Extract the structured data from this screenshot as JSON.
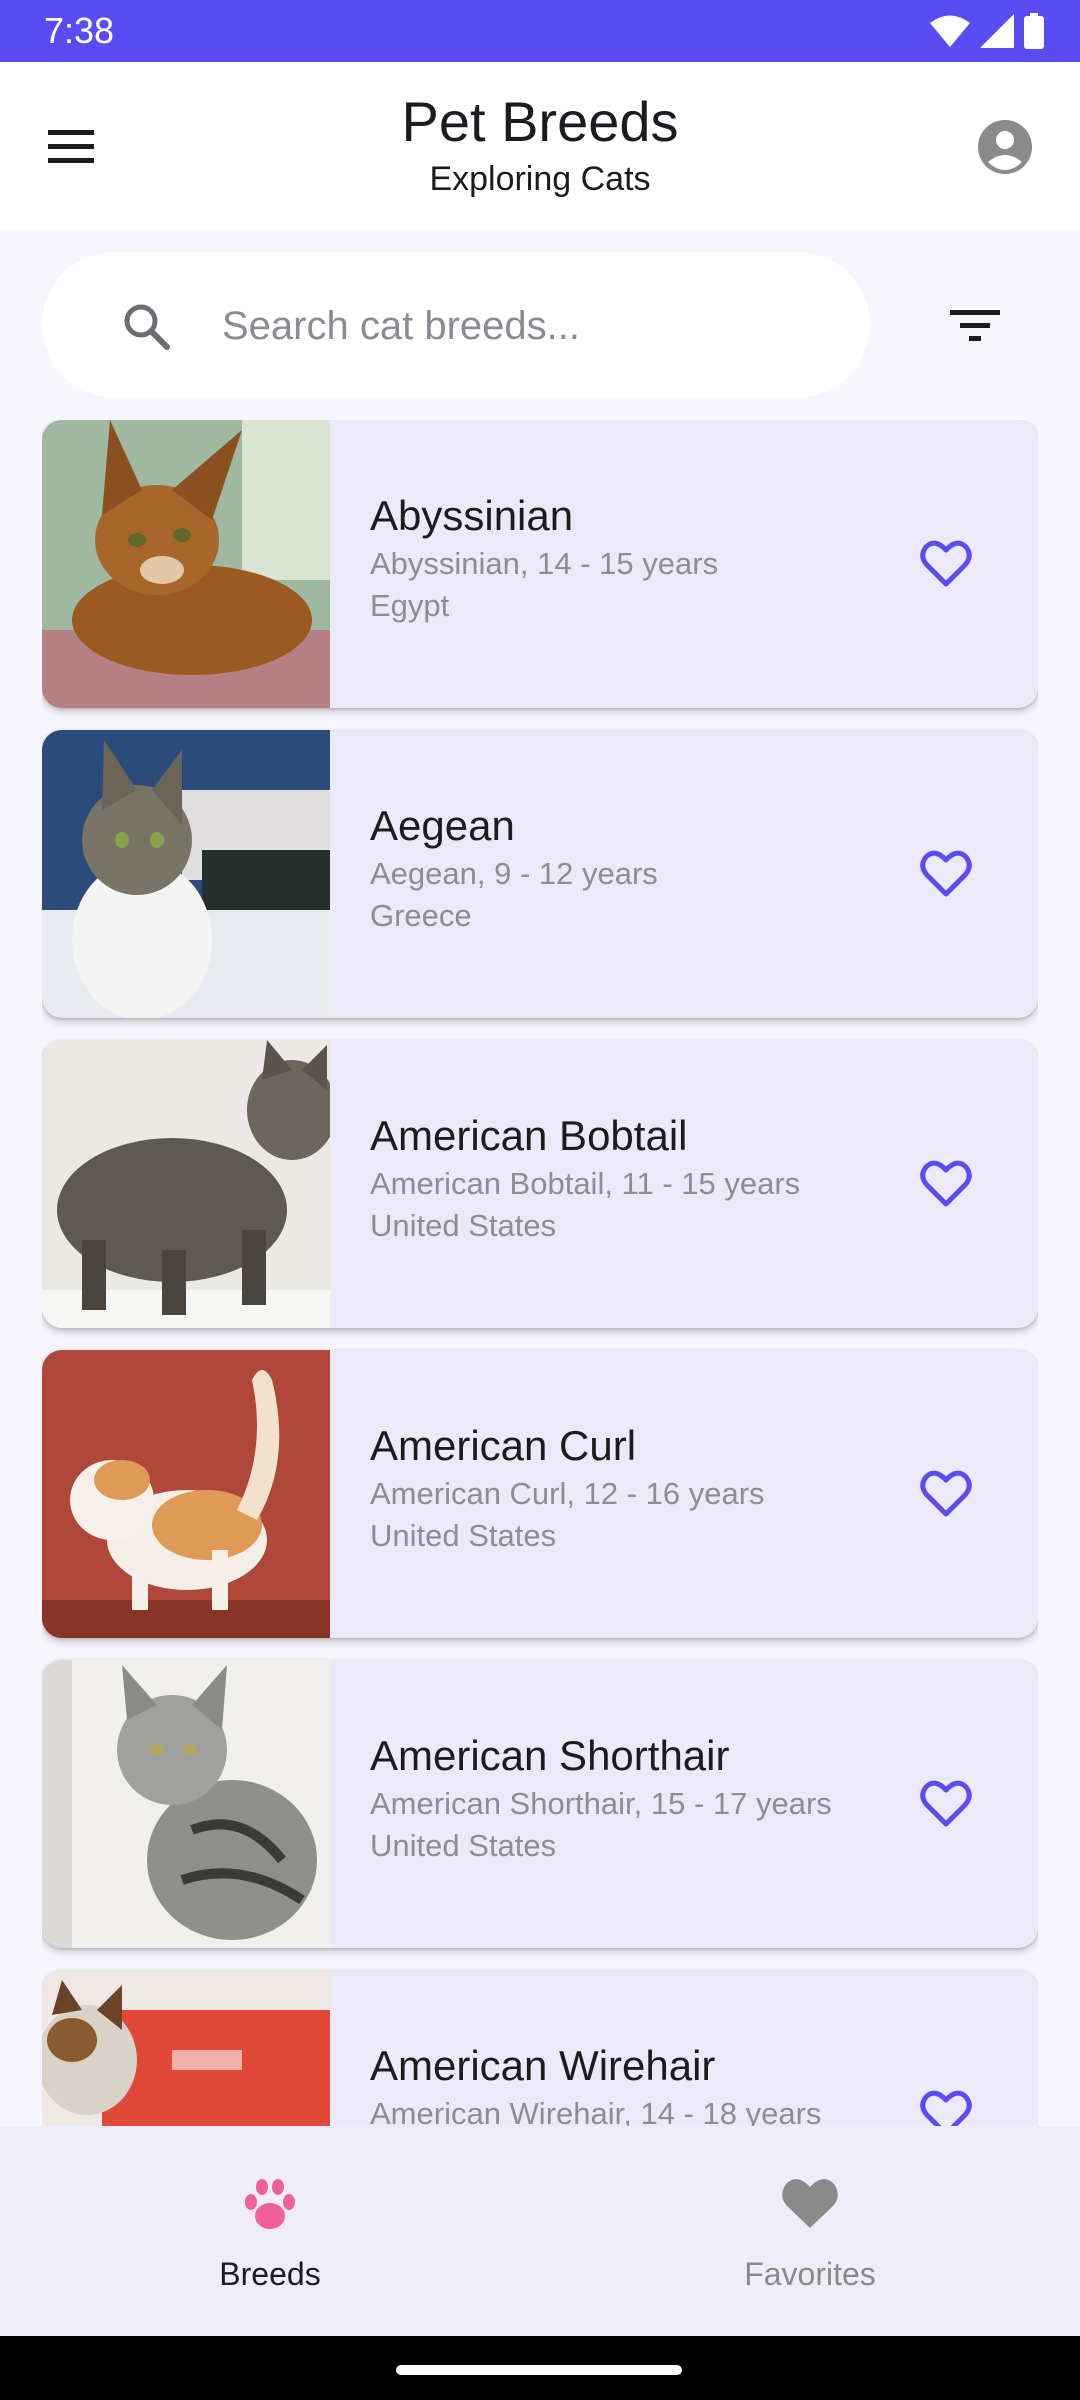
{
  "status_bar": {
    "time": "7:38"
  },
  "app_bar": {
    "title": "Pet Breeds",
    "subtitle": "Exploring Cats"
  },
  "search": {
    "placeholder": "Search cat breeds...",
    "value": ""
  },
  "colors": {
    "accent": "#5a4cf3",
    "favorite_icon": "#5a4cf3",
    "selected_nav": "#f0609a",
    "unselected_nav": "#8a8a8a"
  },
  "breeds": [
    {
      "name": "Abyssinian",
      "detail": "Abyssinian, 14 - 15 years",
      "origin": "Egypt"
    },
    {
      "name": "Aegean",
      "detail": "Aegean, 9 - 12 years",
      "origin": "Greece"
    },
    {
      "name": "American Bobtail",
      "detail": "American Bobtail, 11 - 15 years",
      "origin": "United States"
    },
    {
      "name": "American Curl",
      "detail": "American Curl, 12 - 16 years",
      "origin": "United States"
    },
    {
      "name": "American Shorthair",
      "detail": "American Shorthair, 15 - 17 years",
      "origin": "United States"
    },
    {
      "name": "American Wirehair",
      "detail": "American Wirehair, 14 - 18 years",
      "origin": ""
    }
  ],
  "bottom_nav": {
    "items": [
      {
        "label": "Breeds",
        "icon": "paw-icon",
        "selected": true
      },
      {
        "label": "Favorites",
        "icon": "heart-icon",
        "selected": false
      }
    ]
  }
}
